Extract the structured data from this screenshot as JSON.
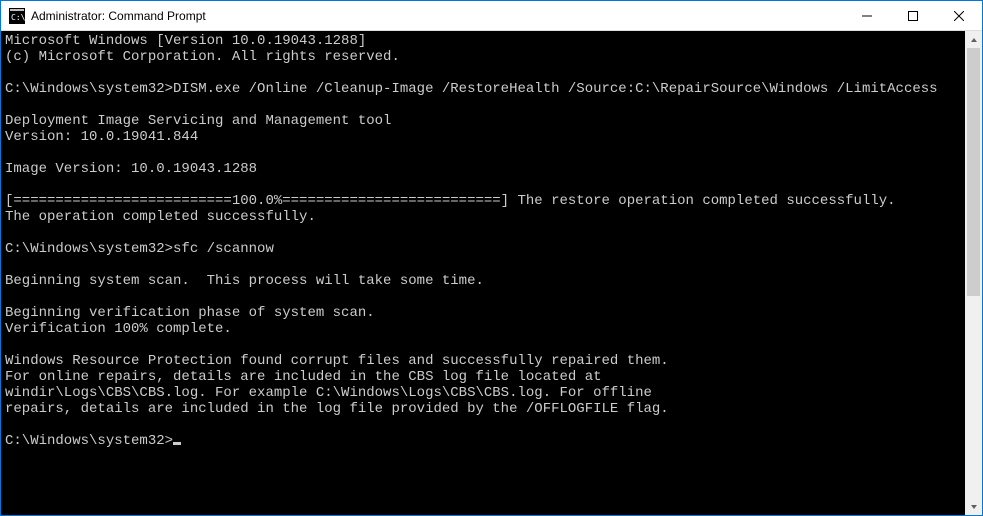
{
  "window": {
    "title": "Administrator: Command Prompt"
  },
  "terminal": {
    "lines": [
      "Microsoft Windows [Version 10.0.19043.1288]",
      "(c) Microsoft Corporation. All rights reserved.",
      "",
      "C:\\Windows\\system32>DISM.exe /Online /Cleanup-Image /RestoreHealth /Source:C:\\RepairSource\\Windows /LimitAccess",
      "",
      "Deployment Image Servicing and Management tool",
      "Version: 10.0.19041.844",
      "",
      "Image Version: 10.0.19043.1288",
      "",
      "[==========================100.0%==========================] The restore operation completed successfully.",
      "The operation completed successfully.",
      "",
      "C:\\Windows\\system32>sfc /scannow",
      "",
      "Beginning system scan.  This process will take some time.",
      "",
      "Beginning verification phase of system scan.",
      "Verification 100% complete.",
      "",
      "Windows Resource Protection found corrupt files and successfully repaired them.",
      "For online repairs, details are included in the CBS log file located at",
      "windir\\Logs\\CBS\\CBS.log. For example C:\\Windows\\Logs\\CBS\\CBS.log. For offline",
      "repairs, details are included in the log file provided by the /OFFLOGFILE flag.",
      ""
    ],
    "prompt": "C:\\Windows\\system32>"
  }
}
